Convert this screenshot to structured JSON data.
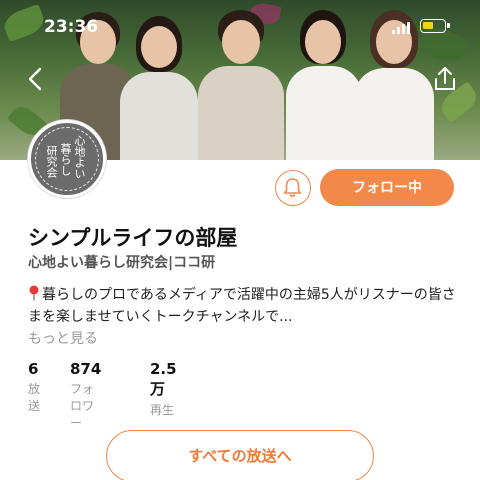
{
  "status_bar": {
    "time": "23:36"
  },
  "channel": {
    "avatar_text": [
      "心地よい",
      "暮らし",
      "研究会"
    ],
    "title": "シンプルライフの部屋",
    "subtitle": "心地よい暮らし研究会|ココ研",
    "description": "暮らしのプロであるメディアで活躍中の主婦5人がリスナーの皆さまを楽しませていくトークチャンネルで...",
    "more_label": "もっと見る"
  },
  "actions": {
    "follow_label": "フォロー中",
    "all_episodes_label": "すべての放送へ"
  },
  "stats": [
    {
      "value": "6",
      "label": "放送"
    },
    {
      "value": "874",
      "label": "フォロワー"
    },
    {
      "value": "2.5万",
      "label": "再生"
    }
  ],
  "colors": {
    "accent": "#f2884a",
    "battery": "#f5d020"
  },
  "icons": [
    "back-arrow-icon",
    "share-icon",
    "bell-icon",
    "location-pin-icon",
    "signal-icon",
    "battery-icon"
  ]
}
